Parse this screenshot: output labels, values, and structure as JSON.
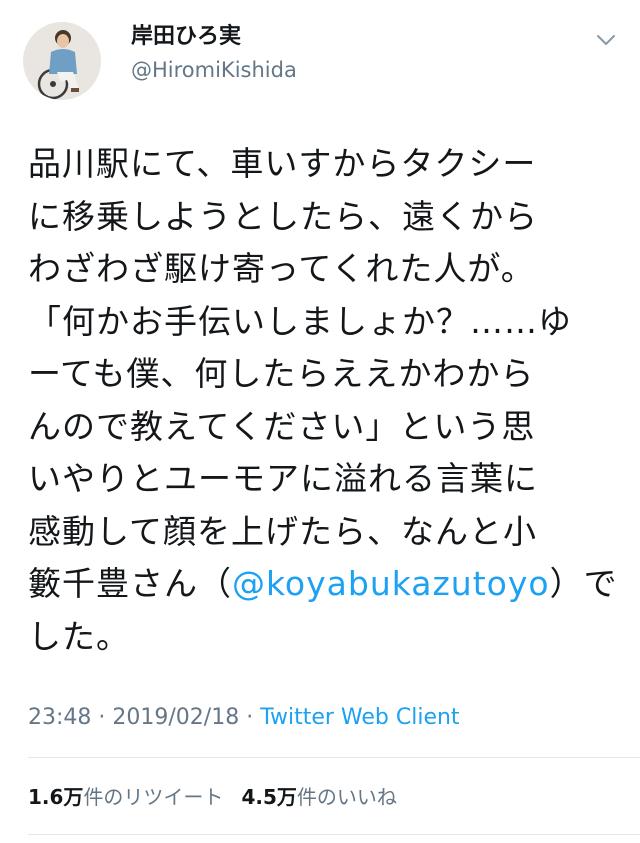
{
  "user": {
    "display_name": "岸田ひろ実",
    "handle": "@HiromiKishida"
  },
  "tweet": {
    "lines": [
      "品川駅にて、車いすからタクシー",
      "に移乗しようとしたら、遠くから",
      "わざわざ駆け寄ってくれた人が。",
      "「何かお手伝いしましょか？……ゆ",
      "ーても僕、何したらええかわから",
      "んので教えてください」という思",
      "いやりとユーモアに溢れる言葉に",
      "感動して顔を上げたら、なんと小"
    ],
    "line9_before": "籔千豊さん（",
    "mention": "@koyabukazutoyo",
    "line9_after": "）で",
    "line10": "した。"
  },
  "meta": {
    "time": "23:48",
    "separator1": " · ",
    "date": "2019/02/18",
    "separator2": " · ",
    "client": "Twitter Web Client"
  },
  "stats": {
    "retweets_count": "1.6万",
    "retweets_label": "件のリツイート",
    "likes_count": "4.5万",
    "likes_label": "件のいいね"
  },
  "colors": {
    "accent": "#1da1f2",
    "secondary_text": "#657786",
    "primary_text": "#14171a",
    "divider": "#e1e8ed"
  },
  "icons": {
    "menu": "chevron-down-icon"
  }
}
